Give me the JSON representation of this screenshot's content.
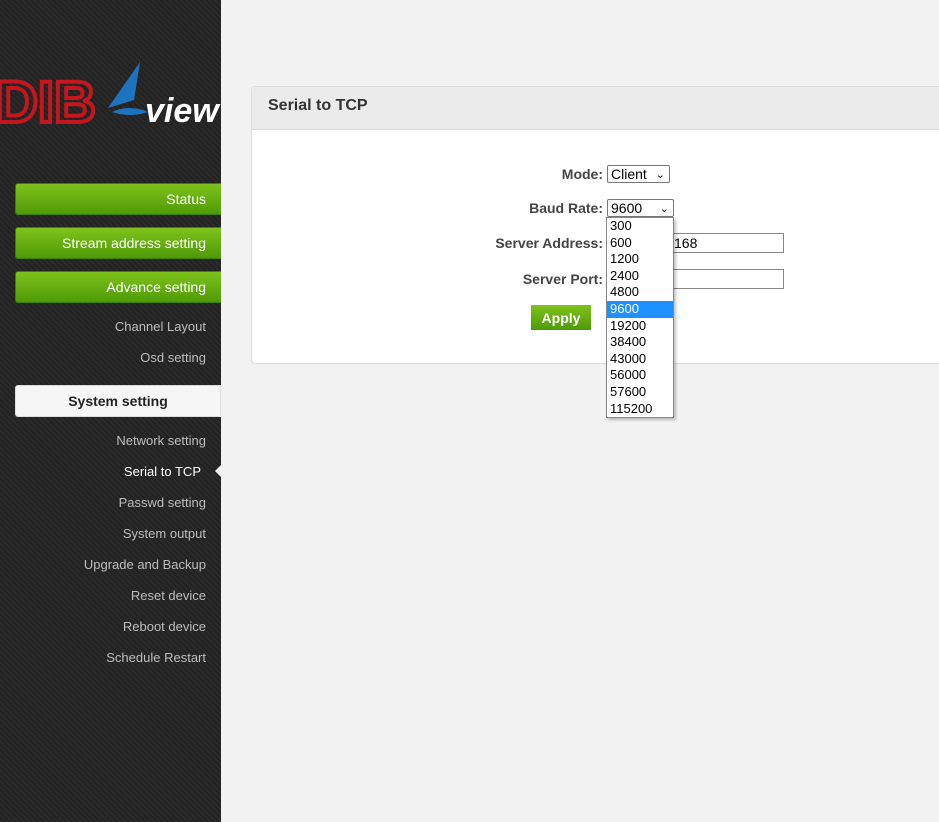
{
  "brand": {
    "part1": "DIB",
    "part2": "view"
  },
  "sidebar": {
    "status": "Status",
    "stream": "Stream address setting",
    "advance": "Advance setting",
    "advance_items": [
      "Channel Layout",
      "Osd setting"
    ],
    "system": "System setting",
    "system_items": [
      "Network setting",
      "Serial to TCP",
      "Passwd setting",
      "System output",
      "Upgrade and Backup",
      "Reset device",
      "Reboot device",
      "Schedule Restart"
    ]
  },
  "panel": {
    "title": "Serial to TCP",
    "mode_label": "Mode:",
    "mode_value": "Client",
    "baud_label": "Baud Rate:",
    "baud_value": "9600",
    "server_address_label": "Server Address:",
    "server_address_value": "168",
    "server_port_label": "Server Port:",
    "server_port_value": "",
    "apply_label": "Apply"
  },
  "baud_options": [
    "300",
    "600",
    "1200",
    "2400",
    "4800",
    "9600",
    "19200",
    "38400",
    "43000",
    "56000",
    "57600",
    "115200"
  ],
  "colors": {
    "accent_green": "#5aa80f",
    "selected_option": "#1e90ff",
    "brand_red": "#c4161c",
    "brand_blue": "#1e73be"
  }
}
